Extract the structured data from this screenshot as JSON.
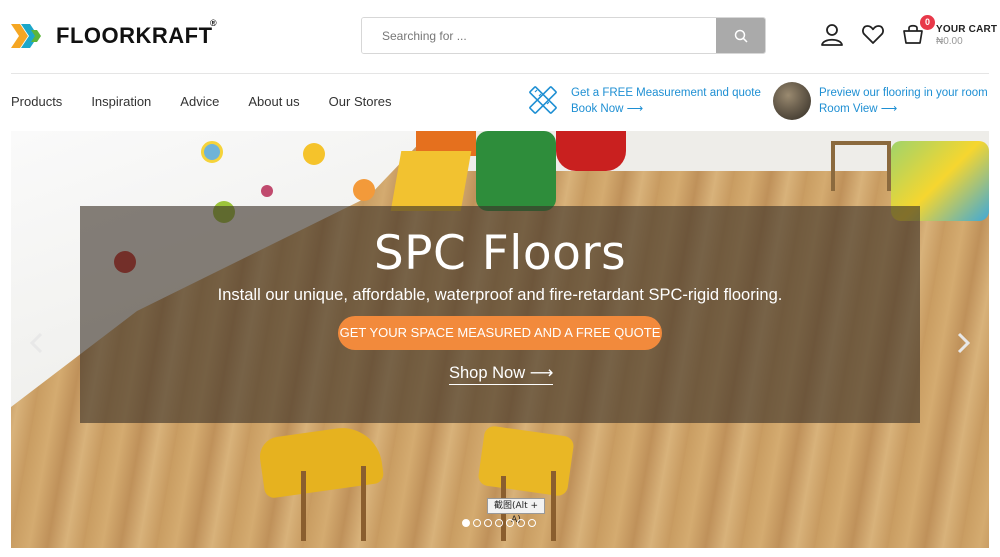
{
  "brand": {
    "name": "FLOORKRAFT",
    "registered": "®",
    "logo_colors": [
      "#f5a623",
      "#1ca7c9",
      "#5bb53a"
    ]
  },
  "search": {
    "placeholder": "Searching for ...",
    "value": "",
    "button_icon": "search-icon"
  },
  "header_icons": {
    "account": "user-icon",
    "wishlist": "heart-icon",
    "cart": "basket-icon"
  },
  "cart": {
    "count": "0",
    "label": "YOUR CART",
    "total": "₦0.00"
  },
  "nav": {
    "items": [
      {
        "label": "Products"
      },
      {
        "label": "Inspiration"
      },
      {
        "label": "Advice"
      },
      {
        "label": "About us"
      },
      {
        "label": "Our Stores"
      }
    ]
  },
  "promos": {
    "measurement": {
      "title": "Get a FREE Measurement and quote",
      "link": "Book Now ⟶",
      "icon": "ruler-pencil-icon"
    },
    "preview": {
      "title": "Preview our flooring in your room",
      "link": "Room View ⟶"
    }
  },
  "hero": {
    "title": "SPC Floors",
    "subtitle": "Install our unique, affordable, waterproof and fire-retardant SPC-rigid flooring.",
    "cta": "GET YOUR SPACE MEASURED AND A FREE QUOTE",
    "shop_link": "Shop Now ⟶",
    "tooltip": "截图(Alt + A)",
    "slides": 7,
    "active_slide": 1
  },
  "colors": {
    "accent_blue": "#1e8fd3",
    "cta_orange": "#f28a3c",
    "badge_red": "#e8394a"
  }
}
